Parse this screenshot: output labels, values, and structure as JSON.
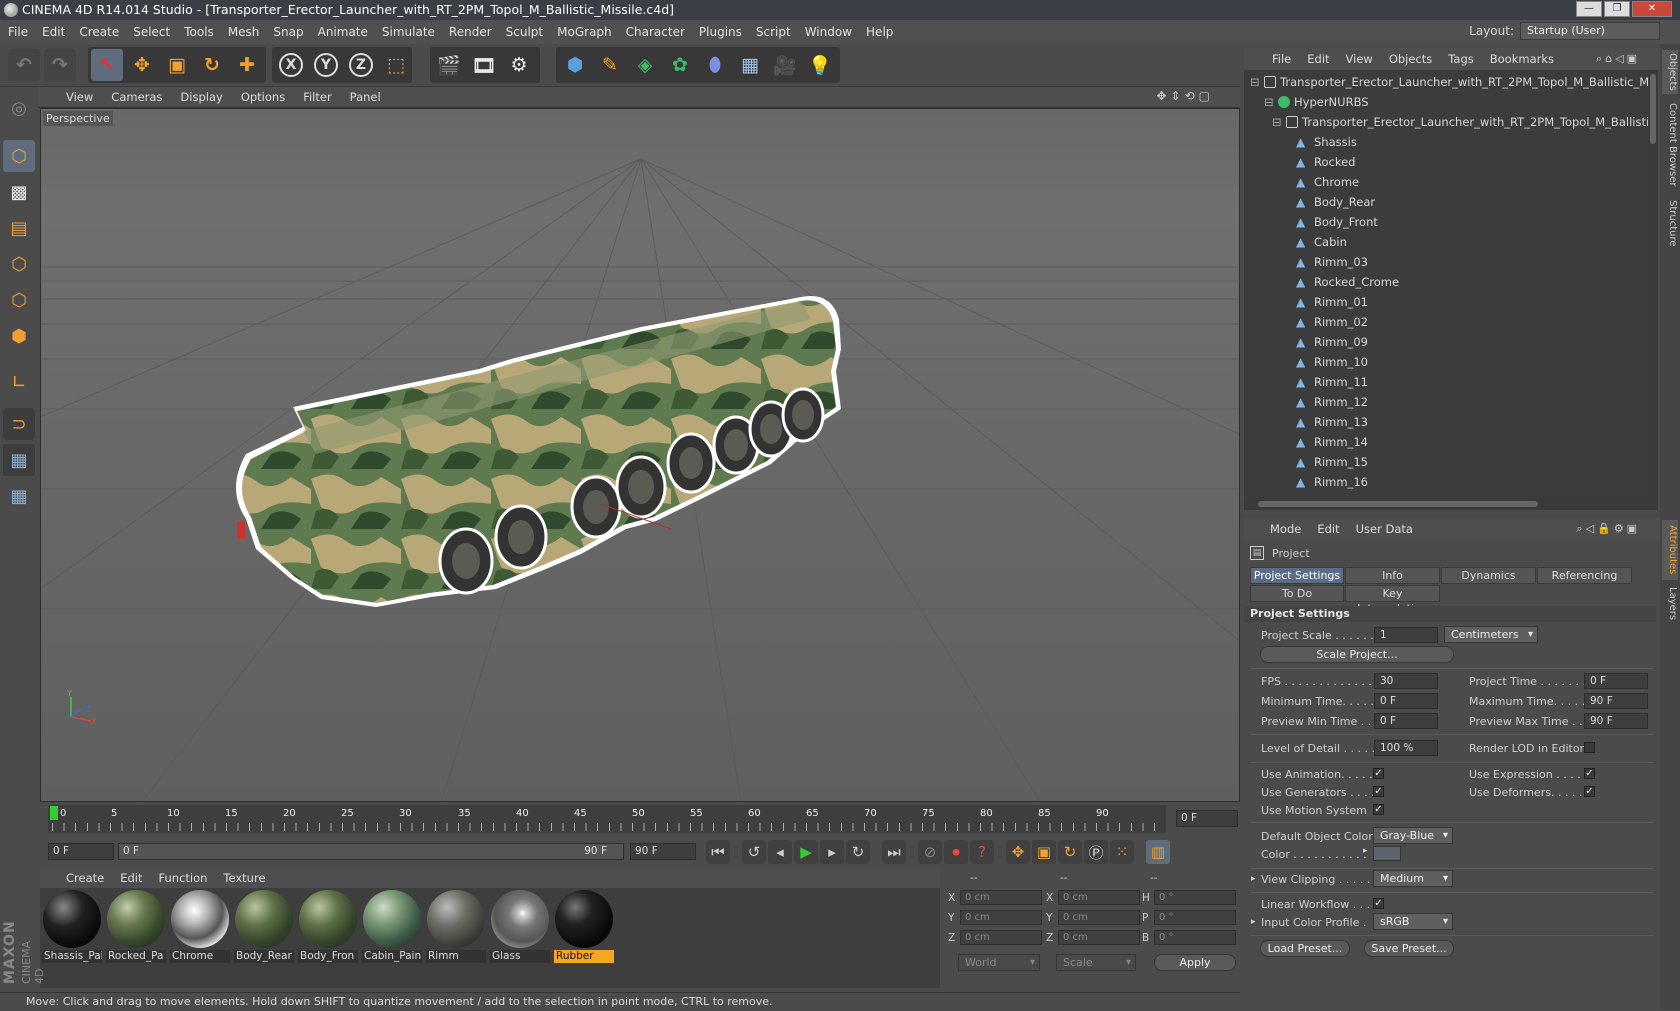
{
  "window": {
    "title": "CINEMA 4D R14.014 Studio - [Transporter_Erector_Launcher_with_RT_2PM_Topol_M_Ballistic_Missile.c4d]",
    "buttons": [
      "—",
      "❐",
      "✕"
    ]
  },
  "menubar": [
    "File",
    "Edit",
    "Create",
    "Select",
    "Tools",
    "Mesh",
    "Snap",
    "Animate",
    "Simulate",
    "Render",
    "Sculpt",
    "MoGraph",
    "Character",
    "Plugins",
    "Script",
    "Window",
    "Help"
  ],
  "layout": {
    "label": "Layout:",
    "value": "Startup (User)"
  },
  "toolbar": {
    "axis_x": "X",
    "axis_y": "Y",
    "axis_z": "Z",
    "icons": [
      "undo-icon",
      "redo-icon",
      "live-selection-icon",
      "move-icon",
      "scale-icon",
      "rotate-icon",
      "recent-tool-icon",
      "lock-x-icon",
      "lock-y-icon",
      "lock-z-icon",
      "coordinate-system-icon",
      "render-view-icon",
      "render-picture-viewer-icon",
      "edit-render-settings-icon",
      "cube-icon",
      "pen-icon",
      "subdivision-icon",
      "cloner-icon",
      "deformer-icon",
      "floor-icon",
      "camera-icon",
      "light-icon"
    ]
  },
  "viewport": {
    "menu": [
      "View",
      "Cameras",
      "Display",
      "Options",
      "Filter",
      "Panel"
    ],
    "camera_label": "Perspective",
    "axis_labels": {
      "x": "X",
      "y": "Y",
      "z": "Z"
    }
  },
  "timeline": {
    "ticks": [
      "0",
      "5",
      "10",
      "15",
      "20",
      "25",
      "30",
      "35",
      "40",
      "45",
      "50",
      "55",
      "60",
      "65",
      "70",
      "75",
      "80",
      "85",
      "90"
    ],
    "current_frame_field": "0 F",
    "start_field": "0 F",
    "range_start": "0 F",
    "range_end": "90 F",
    "end_field": "90 F"
  },
  "materials": {
    "menu": [
      "Create",
      "Edit",
      "Function",
      "Texture"
    ],
    "items": [
      {
        "name": "Shassis_Pai",
        "style": "dark"
      },
      {
        "name": "Rocked_Pa",
        "style": "camo"
      },
      {
        "name": "Chrome",
        "style": "chrome"
      },
      {
        "name": "Body_Rear",
        "style": "camo2"
      },
      {
        "name": "Body_Fron",
        "style": "camo2"
      },
      {
        "name": "Cabin_Pain",
        "style": "pixel"
      },
      {
        "name": "Rimm",
        "style": "rimm"
      },
      {
        "name": "Glass",
        "style": "glass"
      },
      {
        "name": "Rubber",
        "style": "dark",
        "selected": true
      }
    ]
  },
  "coordinates": {
    "col_headers": [
      "--",
      "--",
      "--"
    ],
    "rows": [
      {
        "a": "X",
        "av": "0 cm",
        "b": "X",
        "bv": "0 cm",
        "c": "H",
        "cv": "0 °"
      },
      {
        "a": "Y",
        "av": "0 cm",
        "b": "Y",
        "bv": "0 cm",
        "c": "P",
        "cv": "0 °"
      },
      {
        "a": "Z",
        "av": "0 cm",
        "b": "Z",
        "bv": "0 cm",
        "c": "B",
        "cv": "0 °"
      }
    ],
    "mode1": "World",
    "mode2": "Scale",
    "apply": "Apply"
  },
  "status": "Move: Click and drag to move elements. Hold down SHIFT to quantize movement / add to the selection in point mode, CTRL to remove.",
  "brand": {
    "line1": "MAXON",
    "line2": "CINEMA 4D"
  },
  "object_manager": {
    "menu": [
      "File",
      "Edit",
      "View",
      "Objects",
      "Tags",
      "Bookmarks"
    ],
    "tree": [
      {
        "label": "Transporter_Erector_Launcher_with_RT_2PM_Topol_M_Ballistic_Missile",
        "level": 0,
        "icon": "null"
      },
      {
        "label": "HyperNURBS",
        "level": 1,
        "icon": "nurbs"
      },
      {
        "label": "Transporter_Erector_Launcher_with_RT_2PM_Topol_M_Ballistic_Mis",
        "level": 2,
        "icon": "null"
      },
      {
        "label": "Shassis",
        "level": 3,
        "icon": "poly"
      },
      {
        "label": "Rocked",
        "level": 3,
        "icon": "poly"
      },
      {
        "label": "Chrome",
        "level": 3,
        "icon": "poly"
      },
      {
        "label": "Body_Rear",
        "level": 3,
        "icon": "poly"
      },
      {
        "label": "Body_Front",
        "level": 3,
        "icon": "poly"
      },
      {
        "label": "Cabin",
        "level": 3,
        "icon": "poly"
      },
      {
        "label": "Rimm_03",
        "level": 3,
        "icon": "poly"
      },
      {
        "label": "Rocked_Crome",
        "level": 3,
        "icon": "poly"
      },
      {
        "label": "Rimm_01",
        "level": 3,
        "icon": "poly"
      },
      {
        "label": "Rimm_02",
        "level": 3,
        "icon": "poly"
      },
      {
        "label": "Rimm_09",
        "level": 3,
        "icon": "poly"
      },
      {
        "label": "Rimm_10",
        "level": 3,
        "icon": "poly"
      },
      {
        "label": "Rimm_11",
        "level": 3,
        "icon": "poly"
      },
      {
        "label": "Rimm_12",
        "level": 3,
        "icon": "poly"
      },
      {
        "label": "Rimm_13",
        "level": 3,
        "icon": "poly"
      },
      {
        "label": "Rimm_14",
        "level": 3,
        "icon": "poly"
      },
      {
        "label": "Rimm_15",
        "level": 3,
        "icon": "poly"
      },
      {
        "label": "Rimm_16",
        "level": 3,
        "icon": "poly"
      }
    ]
  },
  "right_tabs": [
    "Objects",
    "Content Browser",
    "Structure",
    "Attributes",
    "Layers"
  ],
  "attributes": {
    "menu": [
      "Mode",
      "Edit",
      "User Data"
    ],
    "title": "Project",
    "tabs_row1": [
      "Project Settings",
      "Info",
      "Dynamics",
      "Referencing"
    ],
    "tabs_row2": [
      "To Do",
      "Key Interpolation"
    ],
    "section": "Project Settings",
    "project_scale_label": "Project Scale . . . . . .",
    "project_scale_value": "1",
    "project_scale_unit": "Centimeters",
    "scale_project_button": "Scale Project...",
    "fps_label": "FPS . . . . . . . . . . . . . . .",
    "fps_value": "30",
    "project_time_label": "Project Time . . . . . . . . .",
    "project_time_value": "0 F",
    "min_time_label": "Minimum Time. . . . . .",
    "min_time_value": "0 F",
    "max_time_label": "Maximum Time. . . . . . .",
    "max_time_value": "90 F",
    "prev_min_label": "Preview Min Time . .",
    "prev_min_value": "0 F",
    "prev_max_label": "Preview Max Time . . .",
    "prev_max_value": "90 F",
    "lod_label": "Level of Detail . . . . .",
    "lod_value": "100 %",
    "render_lod_label": "Render LOD in Editor",
    "use_anim_label": "Use Animation. . . . .",
    "use_expr_label": "Use Expression . . . . .",
    "use_gen_label": "Use Generators . . . .",
    "use_def_label": "Use Deformers. . . . . .",
    "use_motion_label": "Use Motion System",
    "def_color_label": "Default Object Color",
    "def_color_value": "Gray-Blue",
    "color_label": "Color . . . . . . . . . . .",
    "color_swatch": "#5d6470",
    "view_clip_label": "View Clipping . . . . . .",
    "view_clip_value": "Medium",
    "linear_label": "Linear Workflow . . .",
    "icp_label": "Input Color Profile .",
    "icp_value": "sRGB",
    "load_preset": "Load Preset...",
    "save_preset": "Save Preset..."
  },
  "colors": {
    "accent": "#f0a030",
    "selection": "#5b6d86",
    "active_material": "#f5a623"
  }
}
